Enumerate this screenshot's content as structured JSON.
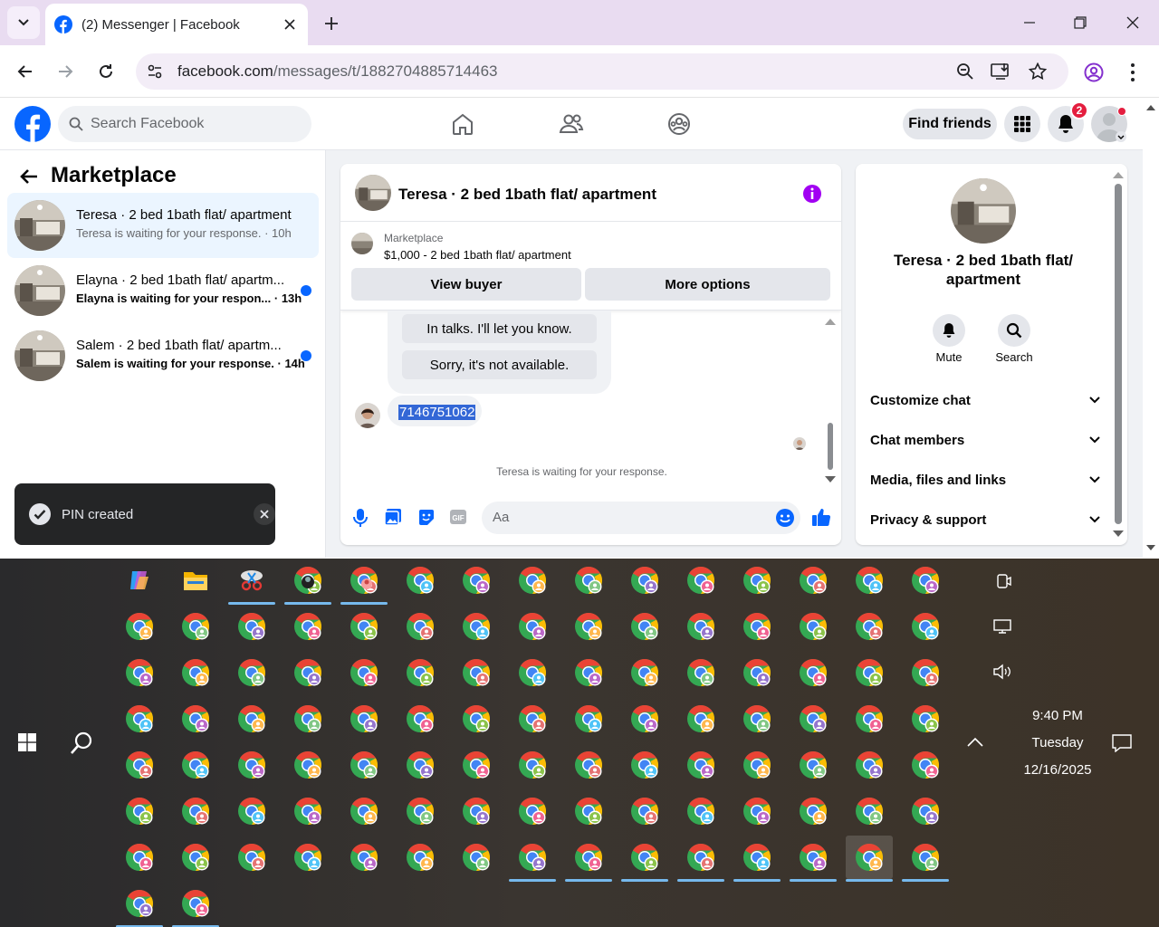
{
  "browser": {
    "tab_title": "(2) Messenger | Facebook",
    "url_host": "facebook.com",
    "url_path": "/messages/t/1882704885714463"
  },
  "fb": {
    "search_placeholder": "Search Facebook",
    "find_friends": "Find friends",
    "notif_count": "2",
    "brand_color": "#0866ff"
  },
  "left": {
    "title": "Marketplace",
    "conversations": [
      {
        "name": "Teresa · 2 bed 1bath flat/ apartment",
        "sub": "Teresa is waiting for your response. · 10h",
        "unread": false
      },
      {
        "name": "Elayna · 2 bed 1bath flat/ apartm...",
        "sub": "Elayna is waiting for your respon... · 13h",
        "unread": true
      },
      {
        "name": "Salem · 2 bed 1bath flat/ apartm...",
        "sub": "Salem is waiting for your response. · 14h",
        "unread": true
      }
    ]
  },
  "toast": {
    "text": "PIN created"
  },
  "chat": {
    "title": "Teresa · 2 bed 1bath flat/ apartment",
    "listing_source": "Marketplace",
    "listing_desc": "$1,000 - 2 bed 1bath flat/ apartment",
    "view_buyer": "View buyer",
    "more_options": "More options",
    "quick_replies": [
      "In talks. I'll let you know.",
      "Sorry, it's not available."
    ],
    "message": "7146751062",
    "status": "Teresa is waiting for your response.",
    "composer_placeholder": "Aa"
  },
  "details": {
    "name": "Teresa · 2 bed 1bath flat/ apartment",
    "mute": "Mute",
    "search": "Search",
    "sections": [
      "Customize chat",
      "Chat members",
      "Media, files and links",
      "Privacy & support"
    ]
  },
  "taskbar": {
    "time": "9:40 PM",
    "day": "Tuesday",
    "date": "12/16/2025"
  }
}
